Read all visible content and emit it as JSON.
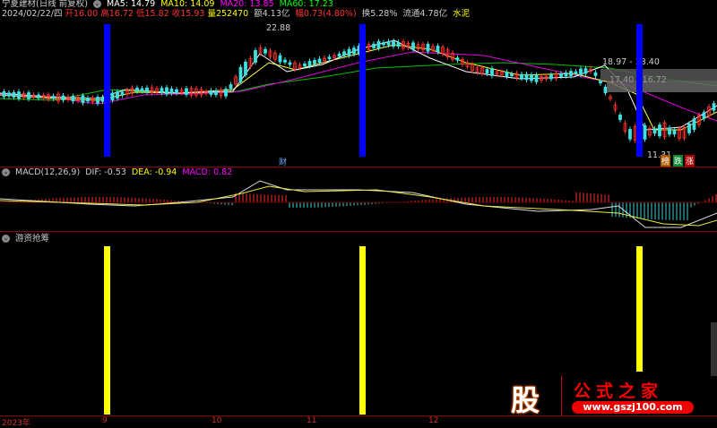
{
  "header": {
    "title": "宁夏建材(日线 前复权)",
    "ma": [
      {
        "label": "MA5: 14.79",
        "color": "#ffffff"
      },
      {
        "label": "MA10: 14.09",
        "color": "#ffff00"
      },
      {
        "label": "MA20: 13.85",
        "color": "#ff00ff"
      },
      {
        "label": "MA60: 17.23",
        "color": "#00ff00"
      }
    ],
    "date": "2024/02/22/四",
    "open": "开16.00",
    "high": "高16.72",
    "low": "低15.82",
    "close": "收15.93",
    "volume": "量252470",
    "amount": "额4.13亿",
    "change": "幅0.73(4.80%)",
    "turnover": "换5.28%",
    "float": "流通4.78亿",
    "sector": "水泥"
  },
  "main_chart": {
    "high_label": "22.88",
    "low_label": "11.31",
    "range_label_1": "18.97 - 18.40",
    "range_label_2": "17.40 - 16.72",
    "marker_cai": "财",
    "badges": [
      {
        "text": "榜",
        "color": "#b05a00"
      },
      {
        "text": "跌",
        "color": "#0a8a2a"
      },
      {
        "text": "涨",
        "color": "#c00000"
      }
    ],
    "signal_color": "#0000ff"
  },
  "macd": {
    "title": "MACD(12,26,9)",
    "dif": "DIF: -0.53",
    "dea": "DEA: -0.94",
    "macd": "MACD: 0.82"
  },
  "indicator": {
    "title": "游资抢筹",
    "signal_color": "#ffff00"
  },
  "x_axis": [
    "2023年",
    "9",
    "10",
    "11",
    "12"
  ],
  "logo": {
    "char": "股",
    "name": "公式之家",
    "url": "www.gszj100.com"
  }
}
